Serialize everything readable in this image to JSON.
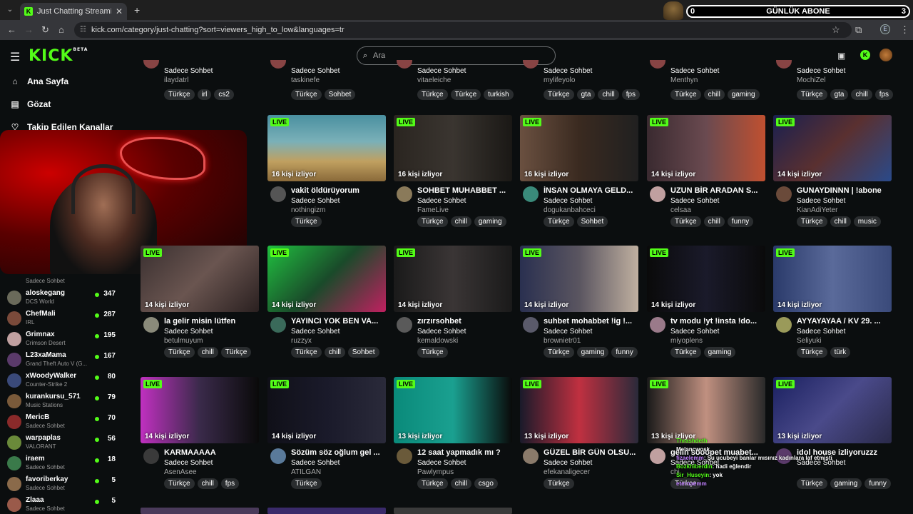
{
  "browser": {
    "tab_title": "Just Chatting Streaming - Live S",
    "url": "kick.com/category/just-chatting?sort=viewers_high_to_low&languages=tr",
    "profile_letter": "E"
  },
  "overlay_sub": {
    "left": "0",
    "title": "GÜNLÜK ABONE",
    "right": "3"
  },
  "header": {
    "logo": "KICK",
    "logo_sup": "BETA",
    "search_placeholder": "Ara"
  },
  "sidebar": {
    "nav": [
      {
        "label": "Ana Sayfa",
        "icon": "home-icon"
      },
      {
        "label": "Gözat",
        "icon": "browse-icon"
      },
      {
        "label": "Takip Edilen Kanallar",
        "icon": "heart-icon"
      }
    ],
    "partial_category": "Sadece Sohbet",
    "channels": [
      {
        "name": "aloskegang",
        "category": "DCS World",
        "viewers": "347",
        "color": "#6a6a5a"
      },
      {
        "name": "ChefMali",
        "category": "IRL",
        "viewers": "287",
        "color": "#7a4a3a"
      },
      {
        "name": "Grimnax",
        "category": "Crimson Desert",
        "viewers": "195",
        "color": "#c0a0a0"
      },
      {
        "name": "L23xaMama",
        "category": "Grand Theft Auto V (G...",
        "viewers": "167",
        "color": "#5a3a6a"
      },
      {
        "name": "xWoodyWalker",
        "category": "Counter-Strike 2",
        "viewers": "80",
        "color": "#3a4a7a"
      },
      {
        "name": "kurankursu_571",
        "category": "Music Stations",
        "viewers": "79",
        "color": "#7a5a3a"
      },
      {
        "name": "MericB",
        "category": "Sadece Sohbet",
        "viewers": "70",
        "color": "#8a2a2a"
      },
      {
        "name": "warpaplas",
        "category": "VALORANT",
        "viewers": "56",
        "color": "#6a8a3a"
      },
      {
        "name": "iraem",
        "category": "Sadece Sohbet",
        "viewers": "18",
        "color": "#3a7a4a"
      },
      {
        "name": "favoriberkay",
        "category": "Sadece Sohbet",
        "viewers": "5",
        "color": "#8a6a4a"
      },
      {
        "name": "Zlaaa",
        "category": "Sadece Sohbet",
        "viewers": "5",
        "color": "#9a5a4a"
      }
    ]
  },
  "live_label": "LIVE",
  "top_row": [
    {
      "category": "Sadece Sohbet",
      "user": "ilaydatrl",
      "tags": [
        "Türkçe",
        "irl",
        "cs2"
      ]
    },
    {
      "category": "Sadece Sohbet",
      "user": "taskinefe",
      "tags": [
        "Türkçe",
        "Sohbet"
      ]
    },
    {
      "category": "Sadece Sohbet",
      "user": "vitaeleiche",
      "tags": [
        "Türkçe",
        "Türkçe",
        "turkish"
      ]
    },
    {
      "category": "Sadece Sohbet",
      "user": "mylifeyolo",
      "tags": [
        "Türkçe",
        "gta",
        "chill",
        "fps"
      ]
    },
    {
      "category": "Sadece Sohbet",
      "user": "Menthyn",
      "tags": [
        "Türkçe",
        "chill",
        "gaming"
      ]
    },
    {
      "category": "Sadece Sohbet",
      "user": "MochiZel",
      "tags": [
        "Türkçe",
        "gta",
        "chill",
        "fps"
      ]
    }
  ],
  "rows": [
    [
      {
        "viewers": "",
        "title": "",
        "category": "",
        "user": "",
        "tags": [],
        "bg": "linear-gradient(135deg,#555,#222)"
      },
      {
        "viewers": "16 kişi izliyor",
        "title": "vakit öldürüyorum",
        "category": "Sadece Sohbet",
        "user": "nothingizm",
        "tags": [
          "Türkçe"
        ],
        "bg": "linear-gradient(180deg,#4a90a0 0%,#7ab0b8 40%,#c0a060 70%,#8a6a3a 100%)",
        "av": "#555"
      },
      {
        "viewers": "16 kişi izliyor",
        "title": "SOHBET MUHABBET ...",
        "category": "Sadece Sohbet",
        "user": "FameLive",
        "tags": [
          "Türkçe",
          "chill",
          "gaming"
        ],
        "bg": "linear-gradient(90deg,#2a2520,#3a3530,#1a1815)",
        "av": "#8a7a5a"
      },
      {
        "viewers": "16 kişi izliyor",
        "title": "İNSAN OLMAYA GELD...",
        "category": "Sadece Sohbet",
        "user": "dogukanbahceci",
        "tags": [
          "Türkçe",
          "Sohbet"
        ],
        "bg": "linear-gradient(90deg,#6a5040,#3a2a20,#202020)",
        "av": "#3a8a7a"
      },
      {
        "viewers": "14 kişi izliyor",
        "title": "UZUN BİR ARADAN S...",
        "category": "Sadece Sohbet",
        "user": "celsaa",
        "tags": [
          "Türkçe",
          "chill",
          "funny"
        ],
        "bg": "linear-gradient(90deg,#3a2a30,#6a4a50,#c05030)",
        "av": "#c0a0a0"
      },
      {
        "viewers": "14 kişi izliyor",
        "title": "GUNAYDINNN | !abone",
        "category": "Sadece Sohbet",
        "user": "KianAdiYeter",
        "tags": [
          "Türkçe",
          "chill",
          "music"
        ],
        "bg": "linear-gradient(135deg,#1a2050,#5a3030,#2a4a8a)",
        "av": "#6a4a3a"
      }
    ],
    [
      {
        "viewers": "14 kişi izliyor",
        "title": "la gelir misin lütfen",
        "category": "Sadece Sohbet",
        "user": "betulmuyum",
        "tags": [
          "Türkçe",
          "chill",
          "Türkçe"
        ],
        "bg": "linear-gradient(135deg,#3a3030,#6a5550,#2a2020)",
        "av": "#8a8a7a"
      },
      {
        "viewers": "14 kişi izliyor",
        "title": "YAYINCI YOK BEN VA...",
        "category": "Sadece Sohbet",
        "user": "ruzzyx",
        "tags": [
          "Türkçe",
          "chill",
          "Sohbet"
        ],
        "bg": "linear-gradient(135deg,#20c040,#1a4a2a,#c02060)",
        "av": "#3a6a5a"
      },
      {
        "viewers": "14 kişi izliyor",
        "title": "zırzırsohbet",
        "category": "Sadece Sohbet",
        "user": "kemaldowski",
        "tags": [
          "Türkçe"
        ],
        "bg": "linear-gradient(90deg,#1a1a1a,#3a3535,#1a1a1a)",
        "av": "#5a5a5a"
      },
      {
        "viewers": "14 kişi izliyor",
        "title": "suhbet mohabbet !ig !...",
        "category": "Sadece Sohbet",
        "user": "brownietr01",
        "tags": [
          "Türkçe",
          "gaming",
          "funny"
        ],
        "bg": "linear-gradient(90deg,#2a3050,#5a5560,#c0b0a0)",
        "av": "#5a5a6a"
      },
      {
        "viewers": "14 kişi izliyor",
        "title": "tv modu !yt !insta !do...",
        "category": "Sadece Sohbet",
        "user": "miyoplens",
        "tags": [
          "Türkçe",
          "gaming"
        ],
        "bg": "linear-gradient(90deg,#0a0a0a,#1a1a2a,#0a0a0a)",
        "av": "#9a7a8a"
      },
      {
        "viewers": "14 kişi izliyor",
        "title": "AYYAYAYAA / KV 29. ...",
        "category": "Sadece Sohbet",
        "user": "Seliyuki",
        "tags": [
          "Türkçe",
          "türk"
        ],
        "bg": "linear-gradient(90deg,#2a3a6a,#5a6a9a,#3a4a7a)",
        "av": "#9a9a5a"
      }
    ],
    [
      {
        "viewers": "14 kişi izliyor",
        "title": "KARMAAAAA",
        "category": "Sadece Sohbet",
        "user": "AsenAsee",
        "tags": [
          "Türkçe",
          "chill",
          "fps"
        ],
        "bg": "linear-gradient(90deg,#c030c0,#3a2a4a,#0a0a0a)",
        "av": "#3a3a3a"
      },
      {
        "viewers": "14 kişi izliyor",
        "title": "Sözüm söz oğlum gel ...",
        "category": "Sadece Sohbet",
        "user": "ATILGAN",
        "tags": [
          "Türkçe"
        ],
        "bg": "linear-gradient(90deg,#101018,#1a1a2a,#2a2a3a)",
        "av": "#5a7a9a"
      },
      {
        "viewers": "13 kişi izliyor",
        "title": "12 saat yapmadık mı ?",
        "category": "Sadece Sohbet",
        "user": "Pawlympus",
        "tags": [
          "Türkçe",
          "chill",
          "csgo"
        ],
        "bg": "linear-gradient(90deg,#0a8a7a,#1aa090,#0a0a0a)",
        "av": "#6a5a3a"
      },
      {
        "viewers": "13 kişi izliyor",
        "title": "GÜZEL BİR GÜN OLSU...",
        "category": "Sadece Sohbet",
        "user": "efekanaligecer",
        "tags": [
          "Türkçe"
        ],
        "bg": "linear-gradient(90deg,#1a1a2a,#c03040,#2a2a3a)",
        "av": "#8a7a6a"
      },
      {
        "viewers": "13 kişi izliyor",
        "title": "gelin sooopet muabet...",
        "category": "Sadece Sohbet",
        "user": "chi",
        "tags": [
          "Türkçe"
        ],
        "bg": "linear-gradient(90deg,#1a1a1a,#c09080,#2a2a2a)",
        "av": "#c0a0a0"
      },
      {
        "viewers": "13 kişi izliyor",
        "title": "idol house izliyoruzzz",
        "category": "Sadece Sohbet",
        "user": "",
        "tags": [
          "Türkçe",
          "gaming",
          "funny"
        ],
        "bg": "linear-gradient(135deg,#1a2060,#4a4a8a,#2a2a4a)",
        "av": "#5a3a6a"
      }
    ]
  ],
  "chat_overlay": [
    {
      "user": "Thrashdeth",
      "msg": "",
      "color": "#53fc18"
    },
    {
      "user": "Melancwosk",
      "msg": "",
      "color": "#fff"
    },
    {
      "user": "fizaelemm",
      "msg": "Şu ucubeyi banlar mısınız kadınlara laf etmişti",
      "color": "#c080ff"
    },
    {
      "user": "Bozkhiberdin",
      "msg": "hadi eğlendir",
      "color": "#53fc18"
    },
    {
      "user": "Sir_Huseyin",
      "msg": "yok",
      "color": "#53fc18"
    },
    {
      "user": "eternaemm",
      "msg": "",
      "color": "#c080ff"
    }
  ]
}
